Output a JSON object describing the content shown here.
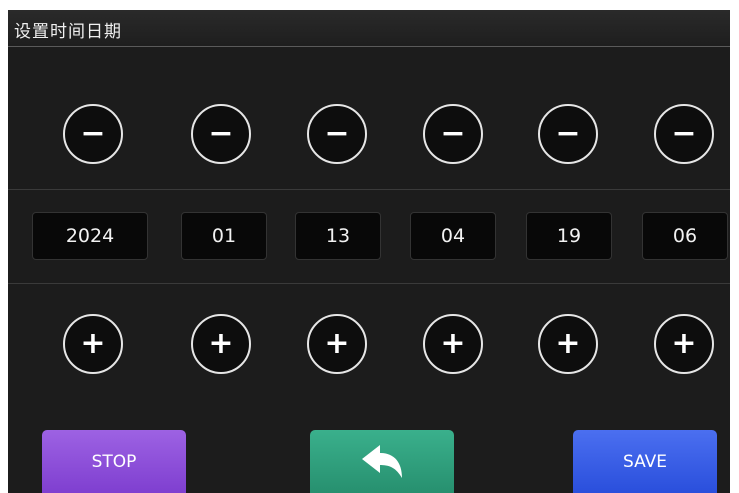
{
  "header": {
    "title": "设置时间日期"
  },
  "decrement": {
    "symbol": "−"
  },
  "increment": {
    "symbol": "+"
  },
  "fields": [
    {
      "value": "2024"
    },
    {
      "value": "01"
    },
    {
      "value": "13"
    },
    {
      "value": "04"
    },
    {
      "value": "19"
    },
    {
      "value": "06"
    }
  ],
  "footer": {
    "stop_label": "STOP",
    "back_icon": "back-arrow-icon",
    "save_label": "SAVE"
  },
  "colors": {
    "background": "#1c1c1c",
    "stop": "#8a4ad8",
    "back": "#2f9f7c",
    "save": "#3a5ee8"
  }
}
